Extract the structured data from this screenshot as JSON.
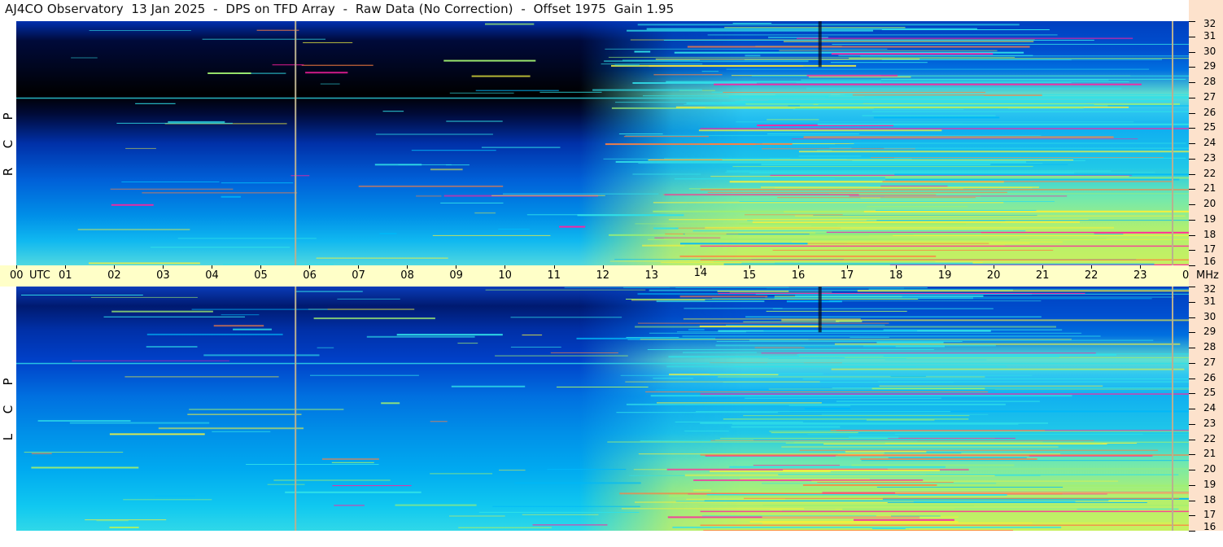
{
  "title": "AJ4CO Observatory  13 Jan 2025  -  DPS on TFD Array  -  Raw Data (No Correction)  -  Offset 1975  Gain 1.95",
  "chart_data": [
    {
      "type": "heatmap",
      "name": "R C P",
      "polarization_label": [
        "R",
        "C",
        "P"
      ],
      "x_unit": "UTC",
      "y_unit": "MHz",
      "x_range": [
        0,
        24
      ],
      "y_range": [
        16,
        32
      ],
      "x_ticks": [
        "00",
        "01",
        "02",
        "03",
        "04",
        "05",
        "06",
        "07",
        "08",
        "09",
        "10",
        "11",
        "12",
        "13",
        "14",
        "15",
        "16",
        "17",
        "18",
        "19",
        "20",
        "21",
        "22",
        "23",
        "00"
      ],
      "y_ticks": [
        32,
        31,
        30,
        29,
        28,
        27,
        26,
        25,
        24,
        23,
        22,
        21,
        20,
        19,
        18,
        17,
        16
      ],
      "vertical_markers_utc": [
        5.7,
        23.65
      ],
      "colormap": [
        "#000000",
        "#000e4a",
        "#0026a8",
        "#0050d8",
        "#0080f0",
        "#00b8f8",
        "#30e0e8",
        "#a0f070",
        "#f0f040",
        "#ff8040",
        "#ff20a0"
      ]
    },
    {
      "type": "heatmap",
      "name": "L C P",
      "polarization_label": [
        "L",
        "C",
        "P"
      ],
      "x_unit": "UTC",
      "y_unit": "MHz",
      "x_range": [
        0,
        24
      ],
      "y_range": [
        16,
        32
      ],
      "x_ticks": [
        "00",
        "01",
        "02",
        "03",
        "04",
        "05",
        "06",
        "07",
        "08",
        "09",
        "10",
        "11",
        "12",
        "13",
        "14",
        "15",
        "16",
        "17",
        "18",
        "19",
        "20",
        "21",
        "22",
        "23",
        "00"
      ],
      "y_ticks": [
        32,
        31,
        30,
        29,
        28,
        27,
        26,
        25,
        24,
        23,
        22,
        21,
        20,
        19,
        18,
        17,
        16
      ],
      "vertical_markers_utc": [
        5.7,
        23.65
      ],
      "colormap": [
        "#000000",
        "#000e4a",
        "#0026a8",
        "#0050d8",
        "#0080f0",
        "#00b8f8",
        "#30e0e8",
        "#a0f070",
        "#f0f040",
        "#ff8040",
        "#ff20a0"
      ]
    }
  ],
  "time_axis": {
    "first_label_suffix": "UTC",
    "last_label_suffix": "MHz"
  }
}
